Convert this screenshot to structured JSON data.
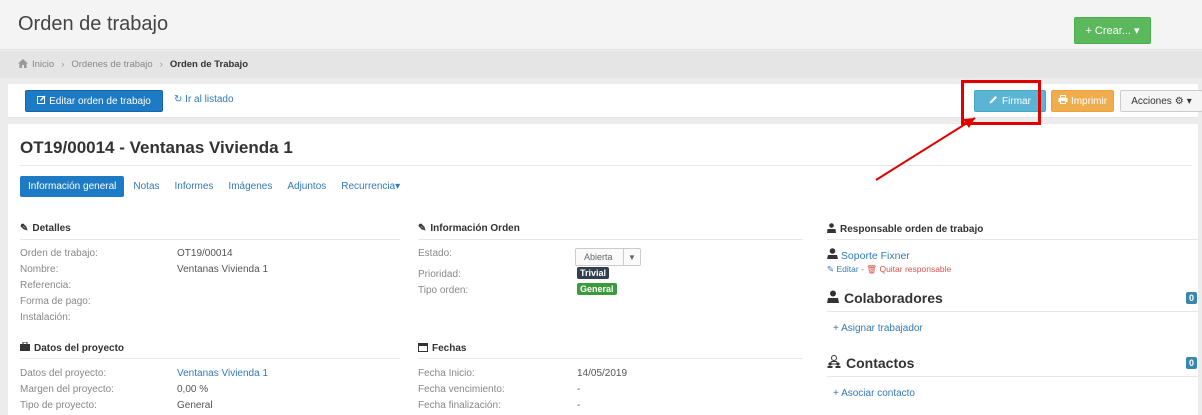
{
  "header": {
    "title": "Orden de trabajo",
    "create_label": "+ Crear... ▾"
  },
  "breadcrumb": {
    "home": "Inicio",
    "ordenes": "Ordenes de trabajo",
    "current": "Orden de Trabajo"
  },
  "toolbar": {
    "edit_label": "Editar orden de trabajo",
    "back_label": "Ir al listado",
    "sign_label": "Firmar",
    "print_label": "Imprimir",
    "actions_label": "Acciones"
  },
  "ot": {
    "title": "OT19/00014 - Ventanas Vivienda 1"
  },
  "tabs": [
    "Información general",
    "Notas",
    "Informes",
    "Imágenes",
    "Adjuntos",
    "Recurrencia▾"
  ],
  "detalles": {
    "heading": "Detalles",
    "labels": [
      "Orden de trabajo:",
      "Nombre:",
      "Referencia:",
      "Forma de pago:",
      "Instalación:"
    ],
    "values": [
      "OT19/00014",
      "Ventanas Vivienda 1",
      "",
      "",
      ""
    ]
  },
  "proyecto": {
    "heading": "Datos del proyecto",
    "labels": [
      "Datos del proyecto:",
      "Margen del proyecto:",
      "Tipo de proyecto:"
    ],
    "values": [
      "Ventanas Vivienda 1",
      "0,00 %",
      "General"
    ]
  },
  "info_orden": {
    "heading": "Información Orden",
    "labels": [
      "Estado:",
      "Prioridad:",
      "Tipo orden:"
    ],
    "estado": "Abierta",
    "prioridad": "Trivial",
    "tipo": "General"
  },
  "fechas": {
    "heading": "Fechas",
    "labels": [
      "Fecha Inicio:",
      "Fecha vencimiento:",
      "Fecha finalización:"
    ],
    "values": [
      "14/05/2019",
      "-",
      "-"
    ]
  },
  "responsable": {
    "heading": "Responsable orden de trabajo",
    "name": "Soporte Fixner",
    "edit": "Editar",
    "sep": " - ",
    "remove": "Quitar responsable"
  },
  "colaboradores": {
    "heading": "Colaboradores",
    "count": "0",
    "assign": "+ Asignar trabajador"
  },
  "contactos": {
    "heading": "Contactos",
    "count": "0",
    "associate": "+ Asociar contacto"
  },
  "colors": {
    "primary": "#1d7ac4",
    "success": "#5cb85c",
    "info": "#5bb4d4",
    "warning": "#f0ad4e",
    "trivial_badge": "#333f4f",
    "general_badge": "#3c9a3c",
    "annotation_red": "#e00000"
  }
}
